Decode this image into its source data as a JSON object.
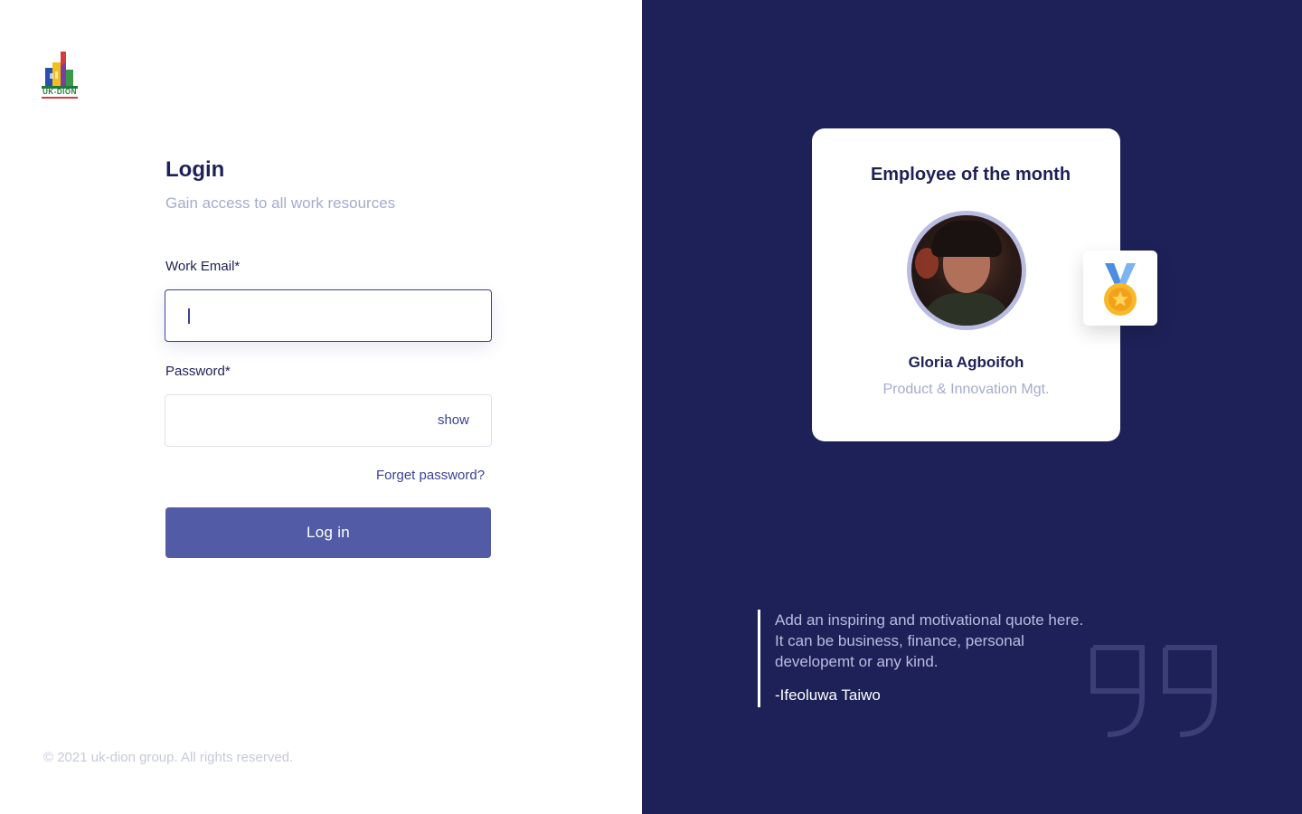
{
  "brand": {
    "logo_text": "UK-DION",
    "colors": {
      "navy": "#1e2158",
      "button": "#525ca6",
      "muted": "#a6abcf",
      "accent": "#3b4196"
    }
  },
  "login": {
    "title": "Login",
    "subtitle": "Gain access to all work resources",
    "email_label": "Work Email*",
    "email_value": "",
    "password_label": "Password*",
    "password_value": "",
    "show_label": "show",
    "forgot_label": "Forget password?",
    "submit_label": "Log in"
  },
  "footer": {
    "copyright": "© 2021 uk-dion group. All rights reserved."
  },
  "employee_card": {
    "title": "Employee of the month",
    "name": "Gloria Agboifoh",
    "role": "Product & Innovation Mgt.",
    "avatar_icon": "avatar-photo",
    "badge_icon": "medal-icon"
  },
  "quote": {
    "text": "Add an inspiring and motivational quote here. It can be business, finance, personal developemt or any kind.",
    "author": "-Ifeoluwa Taiwo",
    "icon": "quote-mark-icon"
  }
}
